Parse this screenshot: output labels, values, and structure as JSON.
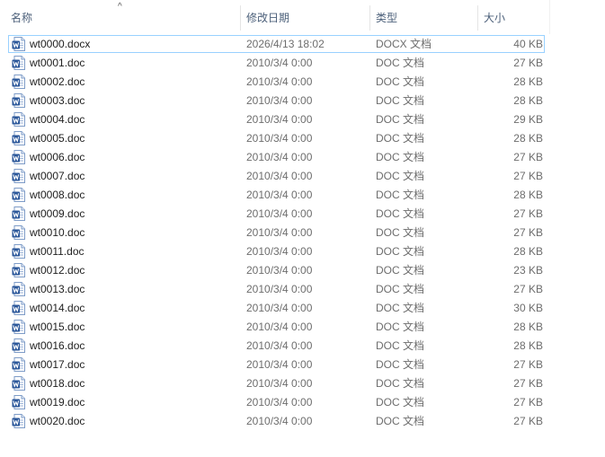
{
  "header": {
    "name": "名称",
    "date": "修改日期",
    "type": "类型",
    "size": "大小",
    "sort_indicator": "^"
  },
  "icon_name": "word-document-icon",
  "accent_color": "#2b579a",
  "selection_border_color": "#99d1ff",
  "files": [
    {
      "name": "wt0000.docx",
      "date": "2026/4/13 18:02",
      "type": "DOCX 文档",
      "size": "40 KB"
    },
    {
      "name": "wt0001.doc",
      "date": "2010/3/4 0:00",
      "type": "DOC 文档",
      "size": "27 KB"
    },
    {
      "name": "wt0002.doc",
      "date": "2010/3/4 0:00",
      "type": "DOC 文档",
      "size": "28 KB"
    },
    {
      "name": "wt0003.doc",
      "date": "2010/3/4 0:00",
      "type": "DOC 文档",
      "size": "28 KB"
    },
    {
      "name": "wt0004.doc",
      "date": "2010/3/4 0:00",
      "type": "DOC 文档",
      "size": "29 KB"
    },
    {
      "name": "wt0005.doc",
      "date": "2010/3/4 0:00",
      "type": "DOC 文档",
      "size": "28 KB"
    },
    {
      "name": "wt0006.doc",
      "date": "2010/3/4 0:00",
      "type": "DOC 文档",
      "size": "27 KB"
    },
    {
      "name": "wt0007.doc",
      "date": "2010/3/4 0:00",
      "type": "DOC 文档",
      "size": "27 KB"
    },
    {
      "name": "wt0008.doc",
      "date": "2010/3/4 0:00",
      "type": "DOC 文档",
      "size": "28 KB"
    },
    {
      "name": "wt0009.doc",
      "date": "2010/3/4 0:00",
      "type": "DOC 文档",
      "size": "27 KB"
    },
    {
      "name": "wt0010.doc",
      "date": "2010/3/4 0:00",
      "type": "DOC 文档",
      "size": "27 KB"
    },
    {
      "name": "wt0011.doc",
      "date": "2010/3/4 0:00",
      "type": "DOC 文档",
      "size": "28 KB"
    },
    {
      "name": "wt0012.doc",
      "date": "2010/3/4 0:00",
      "type": "DOC 文档",
      "size": "23 KB"
    },
    {
      "name": "wt0013.doc",
      "date": "2010/3/4 0:00",
      "type": "DOC 文档",
      "size": "27 KB"
    },
    {
      "name": "wt0014.doc",
      "date": "2010/3/4 0:00",
      "type": "DOC 文档",
      "size": "30 KB"
    },
    {
      "name": "wt0015.doc",
      "date": "2010/3/4 0:00",
      "type": "DOC 文档",
      "size": "28 KB"
    },
    {
      "name": "wt0016.doc",
      "date": "2010/3/4 0:00",
      "type": "DOC 文档",
      "size": "28 KB"
    },
    {
      "name": "wt0017.doc",
      "date": "2010/3/4 0:00",
      "type": "DOC 文档",
      "size": "27 KB"
    },
    {
      "name": "wt0018.doc",
      "date": "2010/3/4 0:00",
      "type": "DOC 文档",
      "size": "27 KB"
    },
    {
      "name": "wt0019.doc",
      "date": "2010/3/4 0:00",
      "type": "DOC 文档",
      "size": "27 KB"
    },
    {
      "name": "wt0020.doc",
      "date": "2010/3/4 0:00",
      "type": "DOC 文档",
      "size": "27 KB"
    }
  ]
}
